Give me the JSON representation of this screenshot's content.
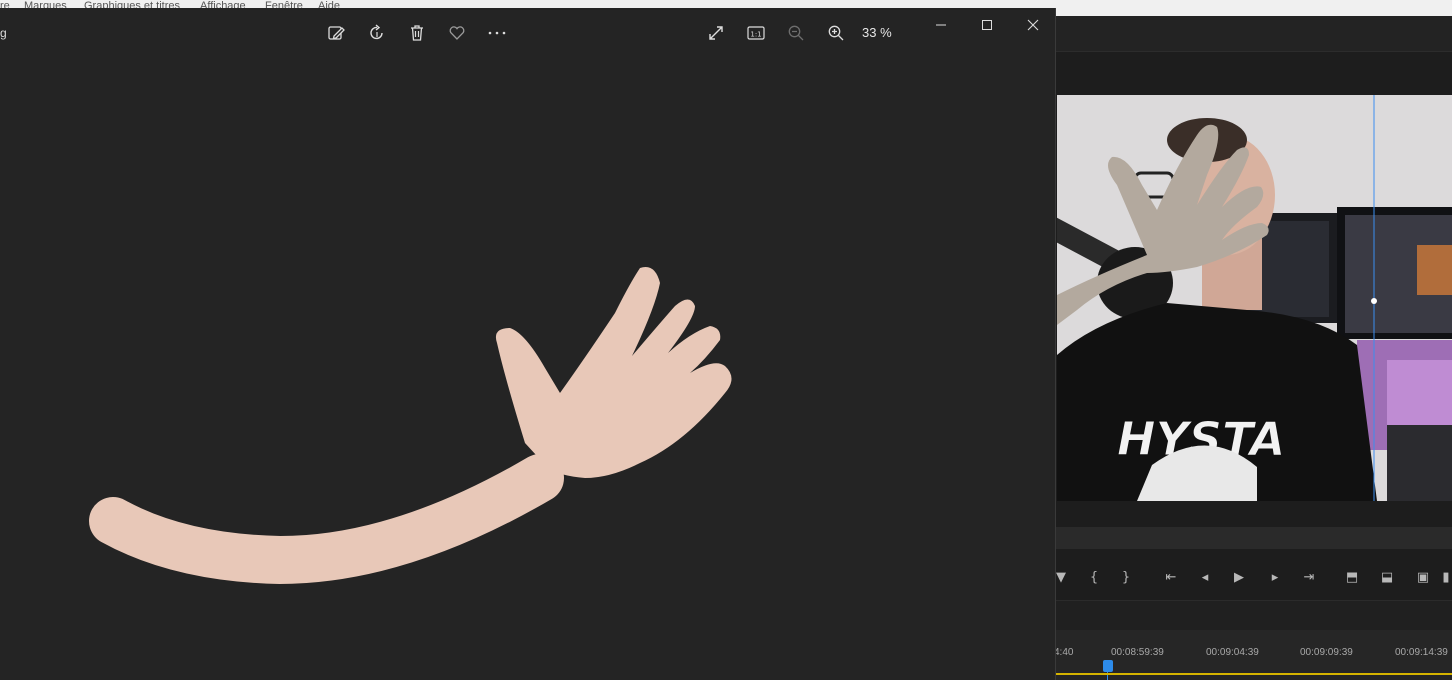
{
  "premiere": {
    "menu": [
      "re",
      "Marques",
      "Graphiques et titres",
      "Affichage",
      "Fenêtre",
      "Aide"
    ],
    "timecodes": [
      "4:40",
      "00:08:59:39",
      "00:09:04:39",
      "00:09:09:39",
      "00:09:14:39"
    ],
    "shirt_text": "HYSTA"
  },
  "photos": {
    "title_fragment": "g",
    "zoom_label": "33 %",
    "toolbar": {
      "edit": "edit-image-icon",
      "rotate": "rotate-icon",
      "delete": "trash-icon",
      "favorite": "heart-icon",
      "more": "more-icon",
      "fullscreen": "expand-icon",
      "actual_size": "actual-size-icon",
      "zoom_out": "zoom-out-icon",
      "zoom_in": "zoom-in-icon"
    },
    "colors": {
      "background": "#242424",
      "arm": "#e8c8b8"
    }
  },
  "colors": {
    "accent": "#2d8ceb",
    "timeline_bar": "#d6b400",
    "hand_overlay": "#b3a99e"
  }
}
